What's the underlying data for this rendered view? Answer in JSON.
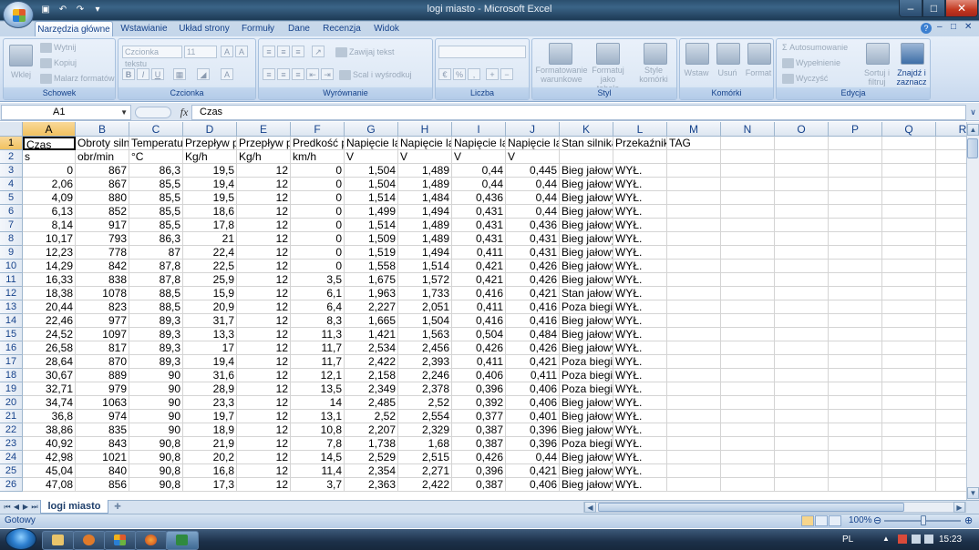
{
  "window": {
    "title": "logi miasto - Microsoft Excel"
  },
  "ribbon": {
    "tabs": [
      "Narzędzia główne",
      "Wstawianie",
      "Układ strony",
      "Formuły",
      "Dane",
      "Recenzja",
      "Widok"
    ],
    "groups": {
      "clipboard": {
        "label": "Schowek",
        "paste": "Wklej",
        "cut": "Wytnij",
        "copy": "Kopiuj",
        "painter": "Malarz formatów"
      },
      "font": {
        "label": "Czcionka",
        "font_name": "Czcionka tekstu",
        "font_size": "11"
      },
      "alignment": {
        "label": "Wyrównanie",
        "wrap": "Zawijaj tekst",
        "merge": "Scal i wyśrodkuj"
      },
      "number": {
        "label": "Liczba"
      },
      "style": {
        "label": "Styl",
        "conditional": "Formatowanie warunkowe",
        "as_table": "Formatuj jako tabelę",
        "cell_styles": "Style komórki"
      },
      "cells": {
        "label": "Komórki",
        "insert": "Wstaw",
        "delete": "Usuń",
        "format": "Format"
      },
      "editing": {
        "label": "Edycja",
        "autosum": "Autosumowanie",
        "fill": "Wypełnienie",
        "clear": "Wyczyść",
        "sort": "Sortuj i filtruj",
        "find": "Znajdź i zaznacz"
      }
    }
  },
  "formula_bar": {
    "name_box": "A1",
    "fx": "fx",
    "content": "Czas"
  },
  "grid": {
    "columns": [
      "A",
      "B",
      "C",
      "D",
      "E",
      "F",
      "G",
      "H",
      "I",
      "J",
      "K",
      "L",
      "M",
      "N",
      "O",
      "P",
      "Q",
      "R"
    ],
    "header_row": [
      "Czas",
      "Obroty siln",
      "Temperatu",
      "Przepływ p",
      "Przepływ p",
      "Predkość p",
      "Napięcie la",
      "Napięcie la",
      "Napięcie la",
      "Napięcie la",
      "Stan silnika",
      "Przekaźnik",
      "TAG"
    ],
    "units_row": [
      "s",
      "obr/min",
      "°C",
      "Kg/h",
      "Kg/h",
      "km/h",
      "V",
      "V",
      "V",
      "V"
    ],
    "rows": [
      [
        "0",
        "867",
        "86,3",
        "19,5",
        "12",
        "0",
        "1,504",
        "1,489",
        "0,44",
        "0,445",
        "Bieg jałowy",
        "WYŁ."
      ],
      [
        "2,06",
        "867",
        "85,5",
        "19,4",
        "12",
        "0",
        "1,504",
        "1,489",
        "0,44",
        "0,44",
        "Bieg jałowy",
        "WYŁ."
      ],
      [
        "4,09",
        "880",
        "85,5",
        "19,5",
        "12",
        "0",
        "1,514",
        "1,484",
        "0,436",
        "0,44",
        "Bieg jałowy",
        "WYŁ."
      ],
      [
        "6,13",
        "852",
        "85,5",
        "18,6",
        "12",
        "0",
        "1,499",
        "1,494",
        "0,431",
        "0,44",
        "Bieg jałowy",
        "WYŁ."
      ],
      [
        "8,14",
        "917",
        "85,5",
        "17,8",
        "12",
        "0",
        "1,514",
        "1,489",
        "0,431",
        "0,436",
        "Bieg jałowy",
        "WYŁ."
      ],
      [
        "10,17",
        "793",
        "86,3",
        "21",
        "12",
        "0",
        "1,509",
        "1,489",
        "0,431",
        "0,431",
        "Bieg jałowy",
        "WYŁ."
      ],
      [
        "12,23",
        "778",
        "87",
        "22,4",
        "12",
        "0",
        "1,519",
        "1,494",
        "0,411",
        "0,431",
        "Bieg jałowy",
        "WYŁ."
      ],
      [
        "14,29",
        "842",
        "87,8",
        "22,5",
        "12",
        "0",
        "1,558",
        "1,514",
        "0,421",
        "0,426",
        "Bieg jałowy",
        "WYŁ."
      ],
      [
        "16,33",
        "838",
        "87,8",
        "25,9",
        "12",
        "3,5",
        "1,675",
        "1,572",
        "0,421",
        "0,426",
        "Bieg jałowy",
        "WYŁ."
      ],
      [
        "18,38",
        "1078",
        "88,5",
        "15,9",
        "12",
        "6,1",
        "1,963",
        "1,733",
        "0,416",
        "0,421",
        "Stan jałowy",
        "WYŁ."
      ],
      [
        "20,44",
        "823",
        "88,5",
        "20,9",
        "12",
        "6,4",
        "2,227",
        "2,051",
        "0,411",
        "0,416",
        "Poza biegiem",
        "WYŁ."
      ],
      [
        "22,46",
        "977",
        "89,3",
        "31,7",
        "12",
        "8,3",
        "1,665",
        "1,504",
        "0,416",
        "0,416",
        "Bieg jałowy",
        "WYŁ."
      ],
      [
        "24,52",
        "1097",
        "89,3",
        "13,3",
        "12",
        "11,3",
        "1,421",
        "1,563",
        "0,504",
        "0,484",
        "Bieg jałowy",
        "WYŁ."
      ],
      [
        "26,58",
        "817",
        "89,3",
        "17",
        "12",
        "11,7",
        "2,534",
        "2,456",
        "0,426",
        "0,426",
        "Bieg jałowy",
        "WYŁ."
      ],
      [
        "28,64",
        "870",
        "89,3",
        "19,4",
        "12",
        "11,7",
        "2,422",
        "2,393",
        "0,411",
        "0,421",
        "Poza biegiem",
        "WYŁ."
      ],
      [
        "30,67",
        "889",
        "90",
        "31,6",
        "12",
        "12,1",
        "2,158",
        "2,246",
        "0,406",
        "0,411",
        "Poza biegiem",
        "WYŁ."
      ],
      [
        "32,71",
        "979",
        "90",
        "28,9",
        "12",
        "13,5",
        "2,349",
        "2,378",
        "0,396",
        "0,406",
        "Poza biegiem",
        "WYŁ."
      ],
      [
        "34,74",
        "1063",
        "90",
        "23,3",
        "12",
        "14",
        "2,485",
        "2,52",
        "0,392",
        "0,406",
        "Bieg jałowy",
        "WYŁ."
      ],
      [
        "36,8",
        "974",
        "90",
        "19,7",
        "12",
        "13,1",
        "2,52",
        "2,554",
        "0,377",
        "0,401",
        "Bieg jałowy",
        "WYŁ."
      ],
      [
        "38,86",
        "835",
        "90",
        "18,9",
        "12",
        "10,8",
        "2,207",
        "2,329",
        "0,387",
        "0,396",
        "Bieg jałowy",
        "WYŁ."
      ],
      [
        "40,92",
        "843",
        "90,8",
        "21,9",
        "12",
        "7,8",
        "1,738",
        "1,68",
        "0,387",
        "0,396",
        "Poza biegiem",
        "WYŁ."
      ],
      [
        "42,98",
        "1021",
        "90,8",
        "20,2",
        "12",
        "14,5",
        "2,529",
        "2,515",
        "0,426",
        "0,44",
        "Bieg jałowy",
        "WYŁ."
      ],
      [
        "45,04",
        "840",
        "90,8",
        "16,8",
        "12",
        "11,4",
        "2,354",
        "2,271",
        "0,396",
        "0,421",
        "Bieg jałowy",
        "WYŁ."
      ],
      [
        "47,08",
        "856",
        "90,8",
        "17,3",
        "12",
        "3,7",
        "2,363",
        "2,422",
        "0,387",
        "0,406",
        "Bieg jałowy",
        "WYŁ."
      ]
    ]
  },
  "sheets": {
    "active": "logi miasto"
  },
  "status": {
    "text": "Gotowy",
    "zoom": "100%"
  },
  "taskbar": {
    "lang": "PL",
    "clock": "15:23"
  }
}
